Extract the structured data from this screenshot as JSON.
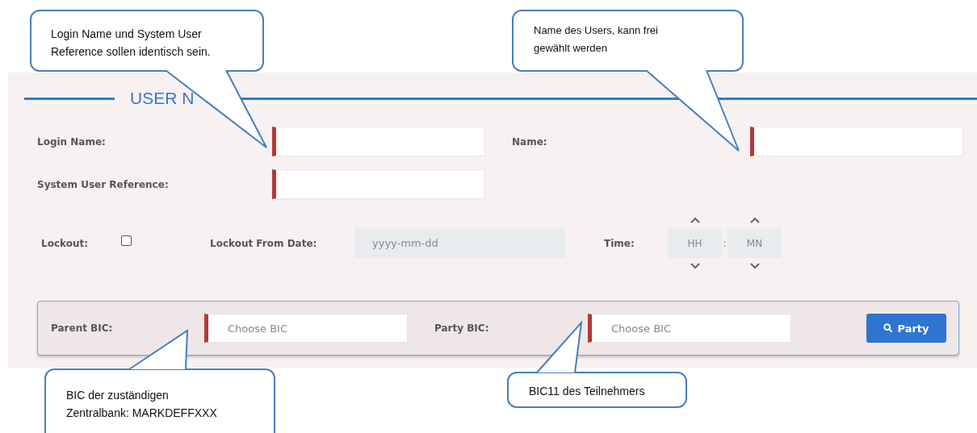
{
  "section": {
    "title": "USER N"
  },
  "fields": [
    {
      "label": "Login Name:",
      "required": true
    },
    {
      "label": "Name:",
      "required": true
    },
    {
      "label": "System User Reference:",
      "required": true
    }
  ],
  "lockout": {
    "label": "Lockout:",
    "checked": false
  },
  "lockout_date": {
    "label": "Lockout From Date:",
    "placeholder": "yyyy-mm-dd"
  },
  "time": {
    "label": "Time:",
    "hours_placeholder": "HH",
    "separator": ":",
    "minutes_placeholder": "MN"
  },
  "bic": {
    "parent": {
      "label": "Parent BIC:",
      "placeholder": "Choose BIC",
      "required": true
    },
    "party": {
      "label": "Party BIC:",
      "placeholder": "Choose BIC",
      "required": true
    },
    "button": "Party"
  },
  "callouts": [
    {
      "lines": [
        "Login Name und System User",
        "Reference sollen identisch sein."
      ]
    },
    {
      "lines": [
        "Name des Users, kann frei",
        "gewählt werden"
      ]
    },
    {
      "lines": [
        "BIC der zuständigen",
        "Zentralbank: MARKDEFFXXX"
      ]
    },
    {
      "lines": [
        "BIC11 des Teilnehmers"
      ]
    }
  ]
}
